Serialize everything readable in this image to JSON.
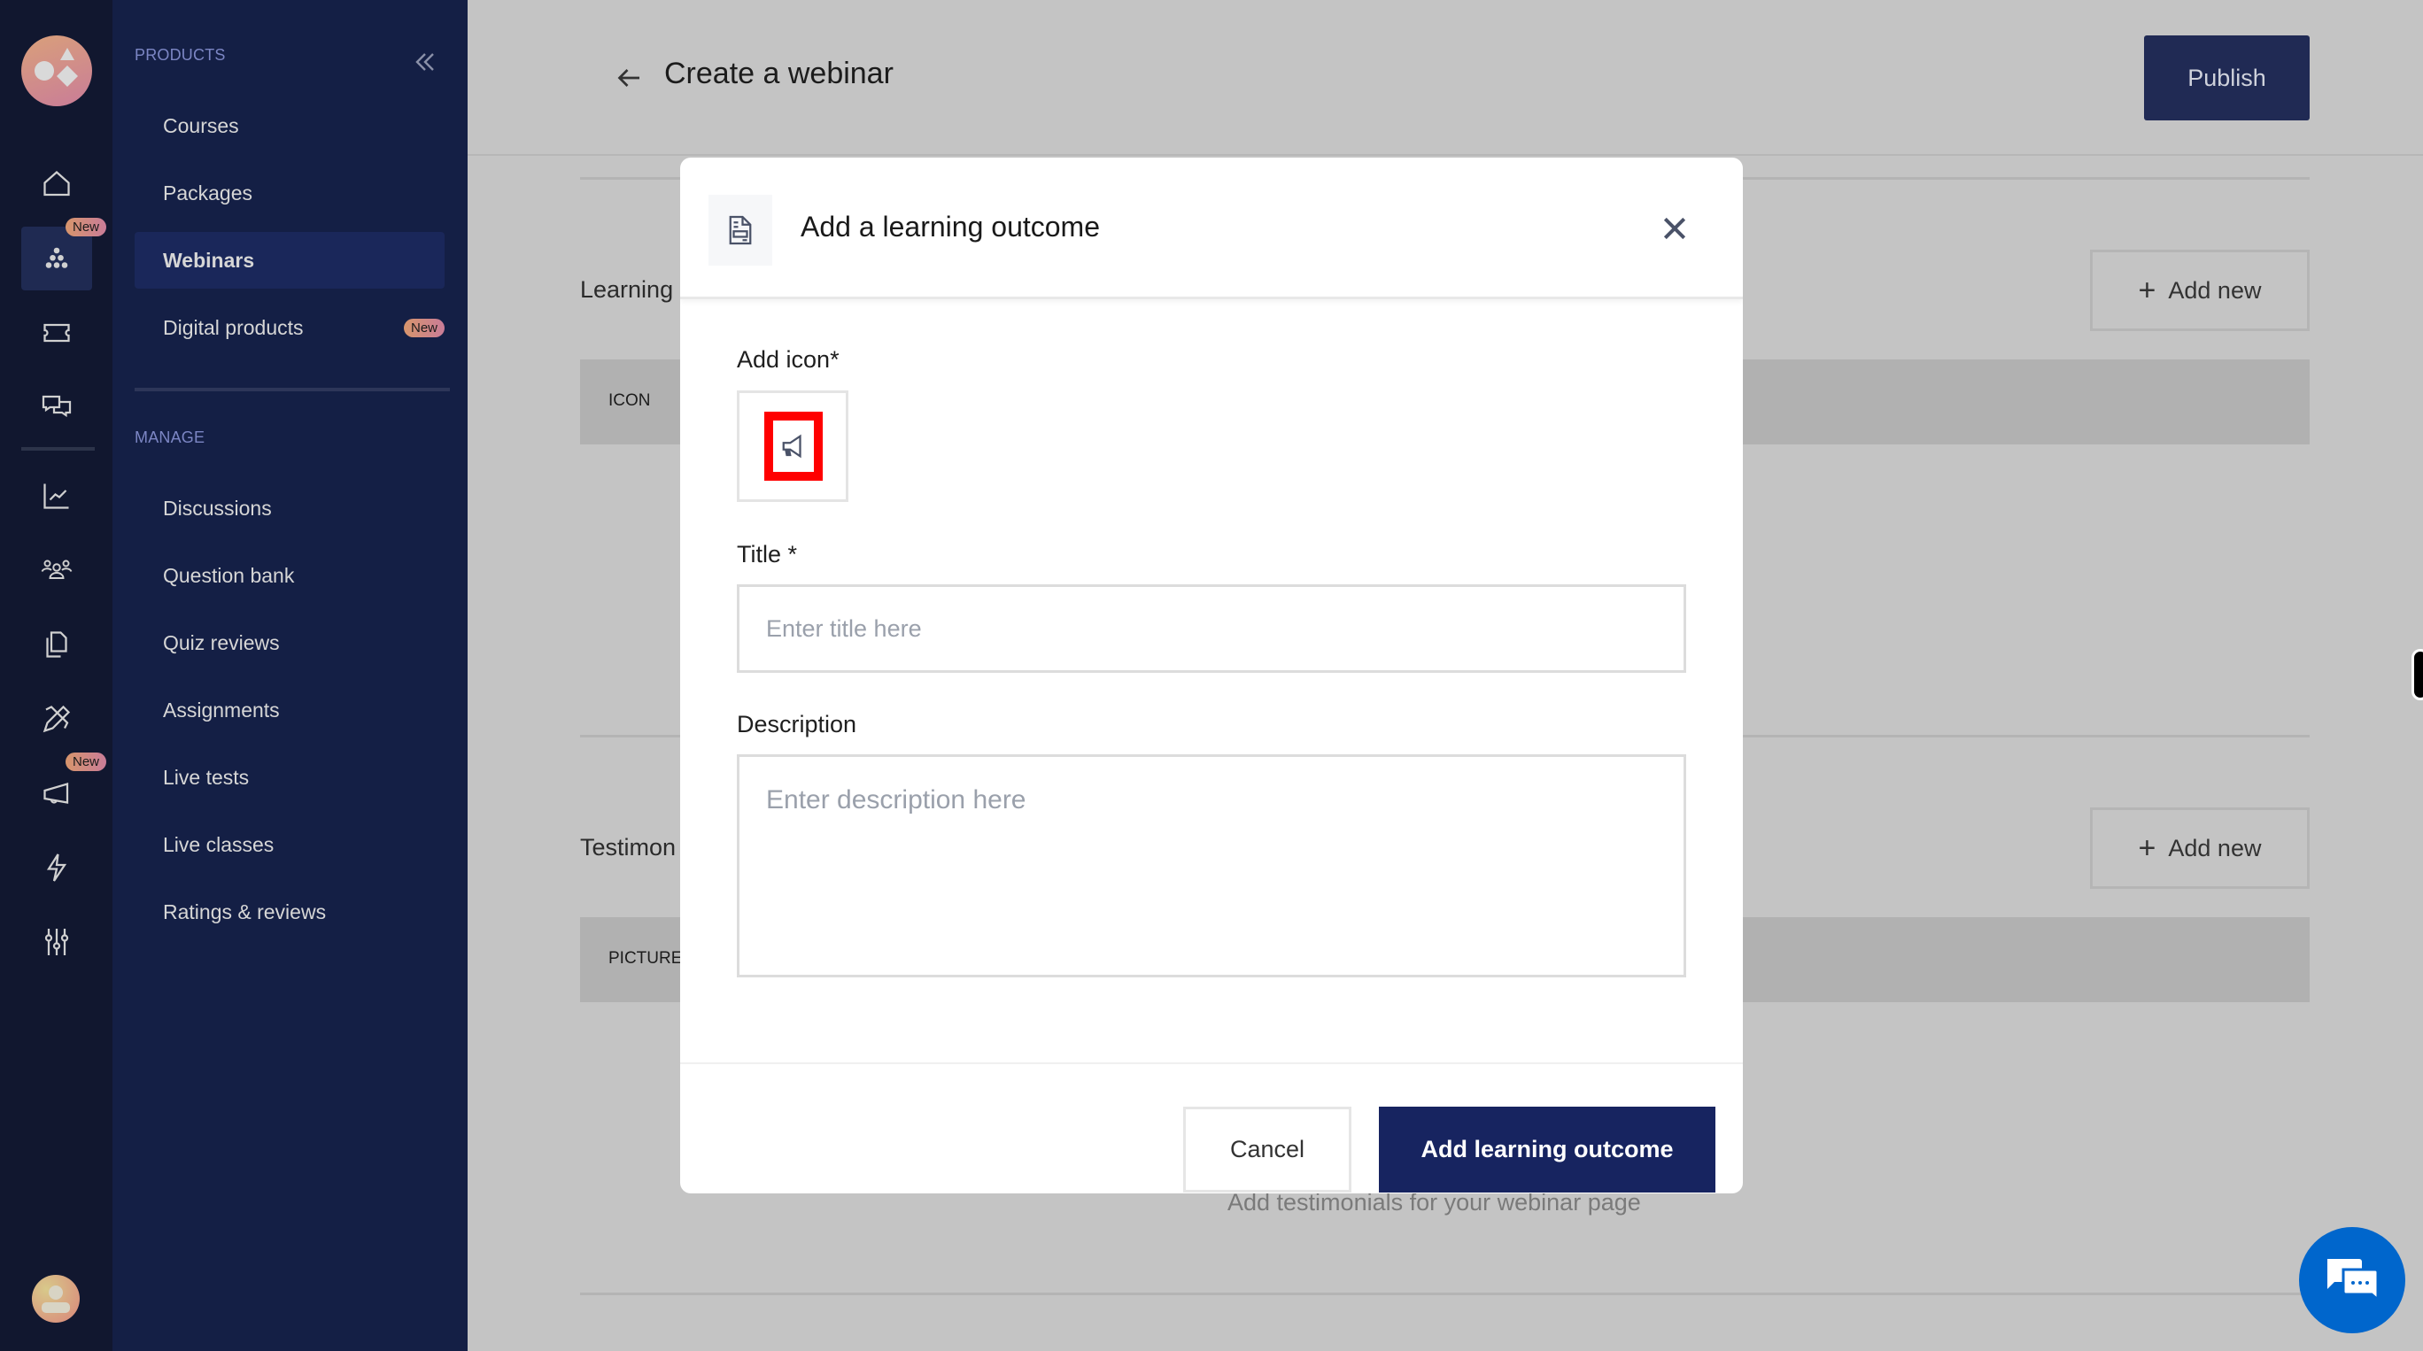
{
  "rail": {
    "badges": {
      "webinars": "New",
      "marketing": "New"
    },
    "icons": [
      "home-icon",
      "products-icon",
      "ticket-icon",
      "chat-icon",
      "analytics-icon",
      "users-icon",
      "documents-icon",
      "tools-icon",
      "megaphone-icon",
      "lightning-icon",
      "settings-sliders-icon"
    ]
  },
  "sidebar": {
    "products_label": "PRODUCTS",
    "manage_label": "MANAGE",
    "products": [
      {
        "label": "Courses"
      },
      {
        "label": "Packages"
      },
      {
        "label": "Webinars",
        "active": true
      },
      {
        "label": "Digital products",
        "badge": "New"
      }
    ],
    "manage": [
      {
        "label": "Discussions"
      },
      {
        "label": "Question bank"
      },
      {
        "label": "Quiz reviews"
      },
      {
        "label": "Assignments"
      },
      {
        "label": "Live tests"
      },
      {
        "label": "Live classes"
      },
      {
        "label": "Ratings & reviews"
      }
    ]
  },
  "header": {
    "title": "Create a webinar",
    "publish_label": "Publish"
  },
  "sections": {
    "learning": {
      "title": "Learning",
      "add_label": "Add new",
      "column": "ICON"
    },
    "testimonials": {
      "title": "Testimon",
      "add_label": "Add new",
      "column": "PICTURE",
      "empty_text": "Add testimonials for your webinar page"
    }
  },
  "modal": {
    "title": "Add a learning outcome",
    "icon_label": "Add icon*",
    "selected_icon": "megaphone-icon",
    "title_label": "Title *",
    "title_value": "",
    "title_placeholder": "Enter title here",
    "description_label": "Description",
    "description_value": "",
    "description_placeholder": "Enter description here",
    "cancel_label": "Cancel",
    "submit_label": "Add learning outcome"
  },
  "colors": {
    "primary": "#172460",
    "highlight": "#ff0000",
    "chat": "#0066cc"
  }
}
